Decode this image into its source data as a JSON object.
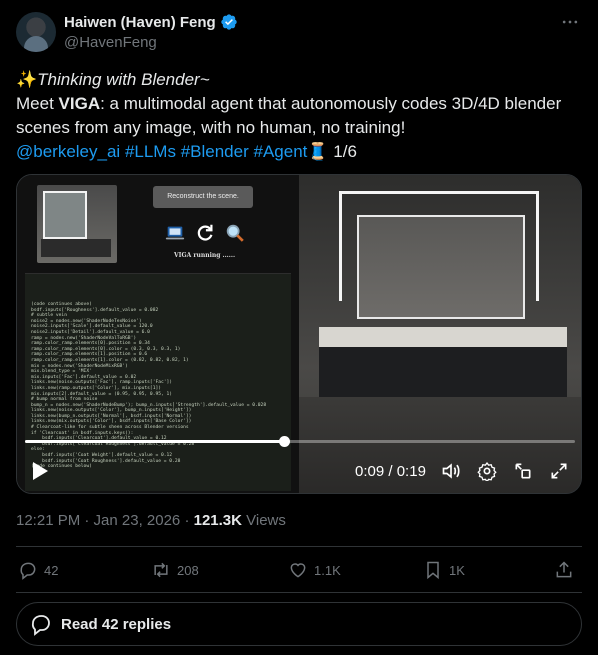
{
  "author": {
    "display_name": "Haiwen (Haven) Feng",
    "handle": "@HavenFeng",
    "verified": true
  },
  "tweet": {
    "sparkle": "✨",
    "title_italic": "Thinking with Blender~",
    "line2_pre": "Meet ",
    "line2_bold": "VIGA",
    "line2_post": ": a multimodal agent that autonomously codes 3D/4D blender scenes from any image, with no human, no training!",
    "mentions": [
      "@berkeley_ai",
      "#LLMs",
      "#Blender",
      "#Agent"
    ],
    "thread_emoji": "🧵",
    "thread_pos": "1/6"
  },
  "media": {
    "reconstruct_label": "Reconstruct the scene.",
    "running_label": "VIGA running ......",
    "code_text": "(code continues above)\nbsdf.inputs['Roughness'].default_value = 0.082\n# subtle vein\nnoise2 = nodes.new('ShaderNodeTexNoise')\nnoise2.inputs['Scale'].default_value = 120.0\nnoise2.inputs['Detail'].default_value = 6.0\nramp = nodes.new('ShaderNodeValToRGB')\nramp.color_ramp.elements[0].position = 0.34\nramp.color_ramp.elements[0].color = (0.3, 0.3, 0.3, 1)\nramp.color_ramp.elements[1].position = 0.6\nramp.color_ramp.elements[1].color = (0.82, 0.82, 0.82, 1)\nmix = nodes.new('ShaderNodeMixRGB')\nmix.blend_type = 'MIX'\nmix.inputs['Fac'].default_value = 0.02\nlinks.new(noise.outputs['Fac'], ramp.inputs['Fac'])\nlinks.new(ramp.outputs['Color'], mix.inputs[1])\nmix.inputs[2].default_value = (0.95, 0.95, 0.95, 1)\n# bump normal from noise\nbump_n = nodes.new('ShaderNodeBump'); bump_n.inputs['Strength'].default_value = 0.028\nlinks.new(noise.outputs['Color'], bump_n.inputs['Height'])\nlinks.new(bump_n.outputs['Normal'], bsdf.inputs['Normal'])\nlinks.new(mix.outputs['Color'], bsdf.inputs['Base Color'])\n# Clearcoat-like for subtle sheen across Blender versions\nif 'Clearcoat' in bsdf.inputs.keys():\n    bsdf.inputs['Clearcoat'].default_value = 0.12\n    bsdf.inputs['Clearcoat Roughness'].default_value = 0.28\nelse:\n    bsdf.inputs['Coat Weight'].default_value = 0.12\n    bsdf.inputs['Coat Roughness'].default_value = 0.28\n(code continues below)",
    "progress": 0.47,
    "time_current": "0:09",
    "time_sep": " / ",
    "time_total": "0:19"
  },
  "meta": {
    "time": "12:21 PM · Jan 23, 2026 · ",
    "views_count": "121.3K",
    "views_label": " Views"
  },
  "actions": {
    "replies": "42",
    "reposts": "208",
    "likes": "1.1K",
    "bookmarks": "1K"
  },
  "read_replies": "Read 42 replies",
  "colors": {
    "accent": "#1d9bf0",
    "background": "#000000",
    "muted": "#71767b"
  }
}
